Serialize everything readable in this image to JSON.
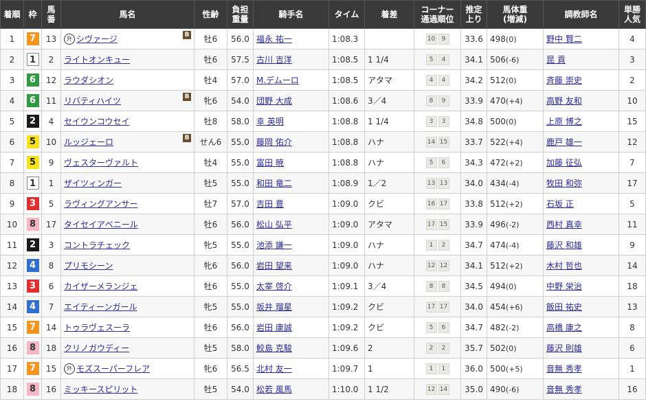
{
  "headers": {
    "rank": "着順",
    "waku": "枠",
    "umaban": [
      "馬",
      "番"
    ],
    "name": "馬名",
    "sexage": "性齢",
    "weight": [
      "負担",
      "重量"
    ],
    "jockey": "騎手名",
    "time": "タイム",
    "margin": "着差",
    "corner": [
      "コーナー",
      "通過順位"
    ],
    "last": [
      "推定",
      "上り"
    ],
    "body": [
      "馬体重",
      "(増減)"
    ],
    "trainer": "調教師名",
    "pop": [
      "単勝",
      "人気"
    ]
  },
  "rows": [
    {
      "rank": "1",
      "waku": "7",
      "umaban": "13",
      "gai": "外",
      "name": "シヴァージ",
      "blinker": "B",
      "sexage": "牡6",
      "weight": "56.0",
      "jockey": "福永 祐一",
      "time": "1:08.3",
      "margin": "",
      "corner": [
        "10",
        "9"
      ],
      "last": "33.6",
      "body": "498",
      "chg": "(0)",
      "trainer": "野中 賢二",
      "pop": "4"
    },
    {
      "rank": "2",
      "waku": "1",
      "umaban": "2",
      "gai": "",
      "name": "ライトオンキュー",
      "blinker": "",
      "sexage": "牡6",
      "weight": "57.5",
      "jockey": "古川 吉洋",
      "time": "1:08.5",
      "margin": "1 1/4",
      "corner": [
        "5",
        "4"
      ],
      "last": "34.1",
      "body": "506",
      "chg": "(-6)",
      "trainer": "昆 貢",
      "pop": "3"
    },
    {
      "rank": "3",
      "waku": "6",
      "umaban": "12",
      "gai": "",
      "name": "ラウダシオン",
      "blinker": "",
      "sexage": "牡4",
      "weight": "57.0",
      "jockey": "M.デムーロ",
      "time": "1:08.5",
      "margin": "アタマ",
      "corner": [
        "4",
        "4"
      ],
      "last": "34.2",
      "body": "512",
      "chg": "(0)",
      "trainer": "斉藤 崇史",
      "pop": "2"
    },
    {
      "rank": "4",
      "waku": "6",
      "umaban": "11",
      "gai": "",
      "name": "リバティハイツ",
      "blinker": "B",
      "sexage": "牝6",
      "weight": "54.0",
      "jockey": "団野 大成",
      "time": "1:08.6",
      "margin": "3／4",
      "corner": [
        "8",
        "9"
      ],
      "last": "33.9",
      "body": "470",
      "chg": "(+4)",
      "trainer": "高野 友和",
      "pop": "10"
    },
    {
      "rank": "5",
      "waku": "2",
      "umaban": "4",
      "gai": "",
      "name": "セイウンコウセイ",
      "blinker": "",
      "sexage": "牡8",
      "weight": "58.0",
      "jockey": "幸 英明",
      "time": "1:08.8",
      "margin": "1 1/4",
      "corner": [
        "3",
        "3"
      ],
      "last": "34.8",
      "body": "500",
      "chg": "(0)",
      "trainer": "上原 博之",
      "pop": "15"
    },
    {
      "rank": "6",
      "waku": "5",
      "umaban": "10",
      "gai": "",
      "name": "ルッジェーロ",
      "blinker": "B",
      "sexage": "せん6",
      "weight": "55.0",
      "jockey": "藤岡 佑介",
      "time": "1:08.8",
      "margin": "ハナ",
      "corner": [
        "14",
        "15"
      ],
      "last": "33.7",
      "body": "522",
      "chg": "(+4)",
      "trainer": "鹿戸 雄一",
      "pop": "12"
    },
    {
      "rank": "7",
      "waku": "5",
      "umaban": "9",
      "gai": "",
      "name": "ヴェスターヴァルト",
      "blinker": "",
      "sexage": "牡4",
      "weight": "55.0",
      "jockey": "富田 暁",
      "time": "1:08.8",
      "margin": "ハナ",
      "corner": [
        "5",
        "6"
      ],
      "last": "34.3",
      "body": "472",
      "chg": "(+2)",
      "trainer": "加藤 征弘",
      "pop": "7"
    },
    {
      "rank": "8",
      "waku": "1",
      "umaban": "1",
      "gai": "",
      "name": "ザイツィンガー",
      "blinker": "",
      "sexage": "牡5",
      "weight": "55.0",
      "jockey": "和田 竜二",
      "time": "1:08.9",
      "margin": "1／2",
      "corner": [
        "13",
        "13"
      ],
      "last": "34.0",
      "body": "434",
      "chg": "(-4)",
      "trainer": "牧田 和弥",
      "pop": "17"
    },
    {
      "rank": "9",
      "waku": "3",
      "umaban": "5",
      "gai": "",
      "name": "ラヴィングアンサー",
      "blinker": "",
      "sexage": "牡7",
      "weight": "57.0",
      "jockey": "吉田 豊",
      "time": "1:09.0",
      "margin": "クビ",
      "corner": [
        "16",
        "17"
      ],
      "last": "33.8",
      "body": "512",
      "chg": "(+2)",
      "trainer": "石坂 正",
      "pop": "5"
    },
    {
      "rank": "10",
      "waku": "8",
      "umaban": "17",
      "gai": "",
      "name": "タイセイアベニール",
      "blinker": "",
      "sexage": "牡6",
      "weight": "56.0",
      "jockey": "松山 弘平",
      "time": "1:09.0",
      "margin": "アタマ",
      "corner": [
        "17",
        "15"
      ],
      "last": "33.9",
      "body": "496",
      "chg": "(-2)",
      "trainer": "西村 真幸",
      "pop": "11"
    },
    {
      "rank": "11",
      "waku": "2",
      "umaban": "3",
      "gai": "",
      "name": "コントラチェック",
      "blinker": "",
      "sexage": "牝5",
      "weight": "55.0",
      "jockey": "池添 謙一",
      "time": "1:09.0",
      "margin": "ハナ",
      "corner": [
        "1",
        "2"
      ],
      "last": "34.7",
      "body": "474",
      "chg": "(-4)",
      "trainer": "藤沢 和雄",
      "pop": "9"
    },
    {
      "rank": "12",
      "waku": "4",
      "umaban": "8",
      "gai": "",
      "name": "プリモシーン",
      "blinker": "",
      "sexage": "牝6",
      "weight": "56.0",
      "jockey": "岩田 望来",
      "time": "1:09.0",
      "margin": "ハナ",
      "corner": [
        "12",
        "12"
      ],
      "last": "34.1",
      "body": "512",
      "chg": "(+2)",
      "trainer": "木村 哲也",
      "pop": "14"
    },
    {
      "rank": "13",
      "waku": "3",
      "umaban": "6",
      "gai": "",
      "name": "カイザーメランジェ",
      "blinker": "",
      "sexage": "牡6",
      "weight": "55.0",
      "jockey": "太宰 啓介",
      "time": "1:09.1",
      "margin": "3／4",
      "corner": [
        "8",
        "8"
      ],
      "last": "34.5",
      "body": "494",
      "chg": "(0)",
      "trainer": "中野 栄治",
      "pop": "18"
    },
    {
      "rank": "14",
      "waku": "4",
      "umaban": "7",
      "gai": "",
      "name": "エイティーンガール",
      "blinker": "",
      "sexage": "牝5",
      "weight": "55.0",
      "jockey": "坂井 瑠星",
      "time": "1:09.2",
      "margin": "クビ",
      "corner": [
        "17",
        "17"
      ],
      "last": "34.0",
      "body": "454",
      "chg": "(+6)",
      "trainer": "飯田 祐史",
      "pop": "13"
    },
    {
      "rank": "15",
      "waku": "7",
      "umaban": "14",
      "gai": "",
      "name": "トゥラヴェスーラ",
      "blinker": "",
      "sexage": "牡6",
      "weight": "56.0",
      "jockey": "岩田 康誠",
      "time": "1:09.2",
      "margin": "クビ",
      "corner": [
        "5",
        "6"
      ],
      "last": "34.7",
      "body": "482",
      "chg": "(-2)",
      "trainer": "高橋 康之",
      "pop": "8"
    },
    {
      "rank": "16",
      "waku": "8",
      "umaban": "18",
      "gai": "",
      "name": "クリノガウディー",
      "blinker": "",
      "sexage": "牡5",
      "weight": "58.0",
      "jockey": "鮫島 克駿",
      "time": "1:09.6",
      "margin": "2",
      "corner": [
        "2",
        "2"
      ],
      "last": "35.7",
      "body": "502",
      "chg": "(0)",
      "trainer": "藤沢 則雄",
      "pop": "6"
    },
    {
      "rank": "17",
      "waku": "7",
      "umaban": "15",
      "gai": "外",
      "name": "モズスーパーフレア",
      "blinker": "",
      "sexage": "牝6",
      "weight": "56.5",
      "jockey": "北村 友一",
      "time": "1:09.7",
      "margin": "1",
      "corner": [
        "1",
        "1"
      ],
      "last": "36.0",
      "body": "500",
      "chg": "(+5)",
      "trainer": "音無 秀孝",
      "pop": "1"
    },
    {
      "rank": "18",
      "waku": "8",
      "umaban": "16",
      "gai": "",
      "name": "ミッキースピリット",
      "blinker": "",
      "sexage": "牡5",
      "weight": "54.0",
      "jockey": "松若 風馬",
      "time": "1:10.0",
      "margin": "1 1/2",
      "corner": [
        "12",
        "14"
      ],
      "last": "35.0",
      "body": "490",
      "chg": "(-6)",
      "trainer": "音無 秀孝",
      "pop": "16"
    }
  ]
}
